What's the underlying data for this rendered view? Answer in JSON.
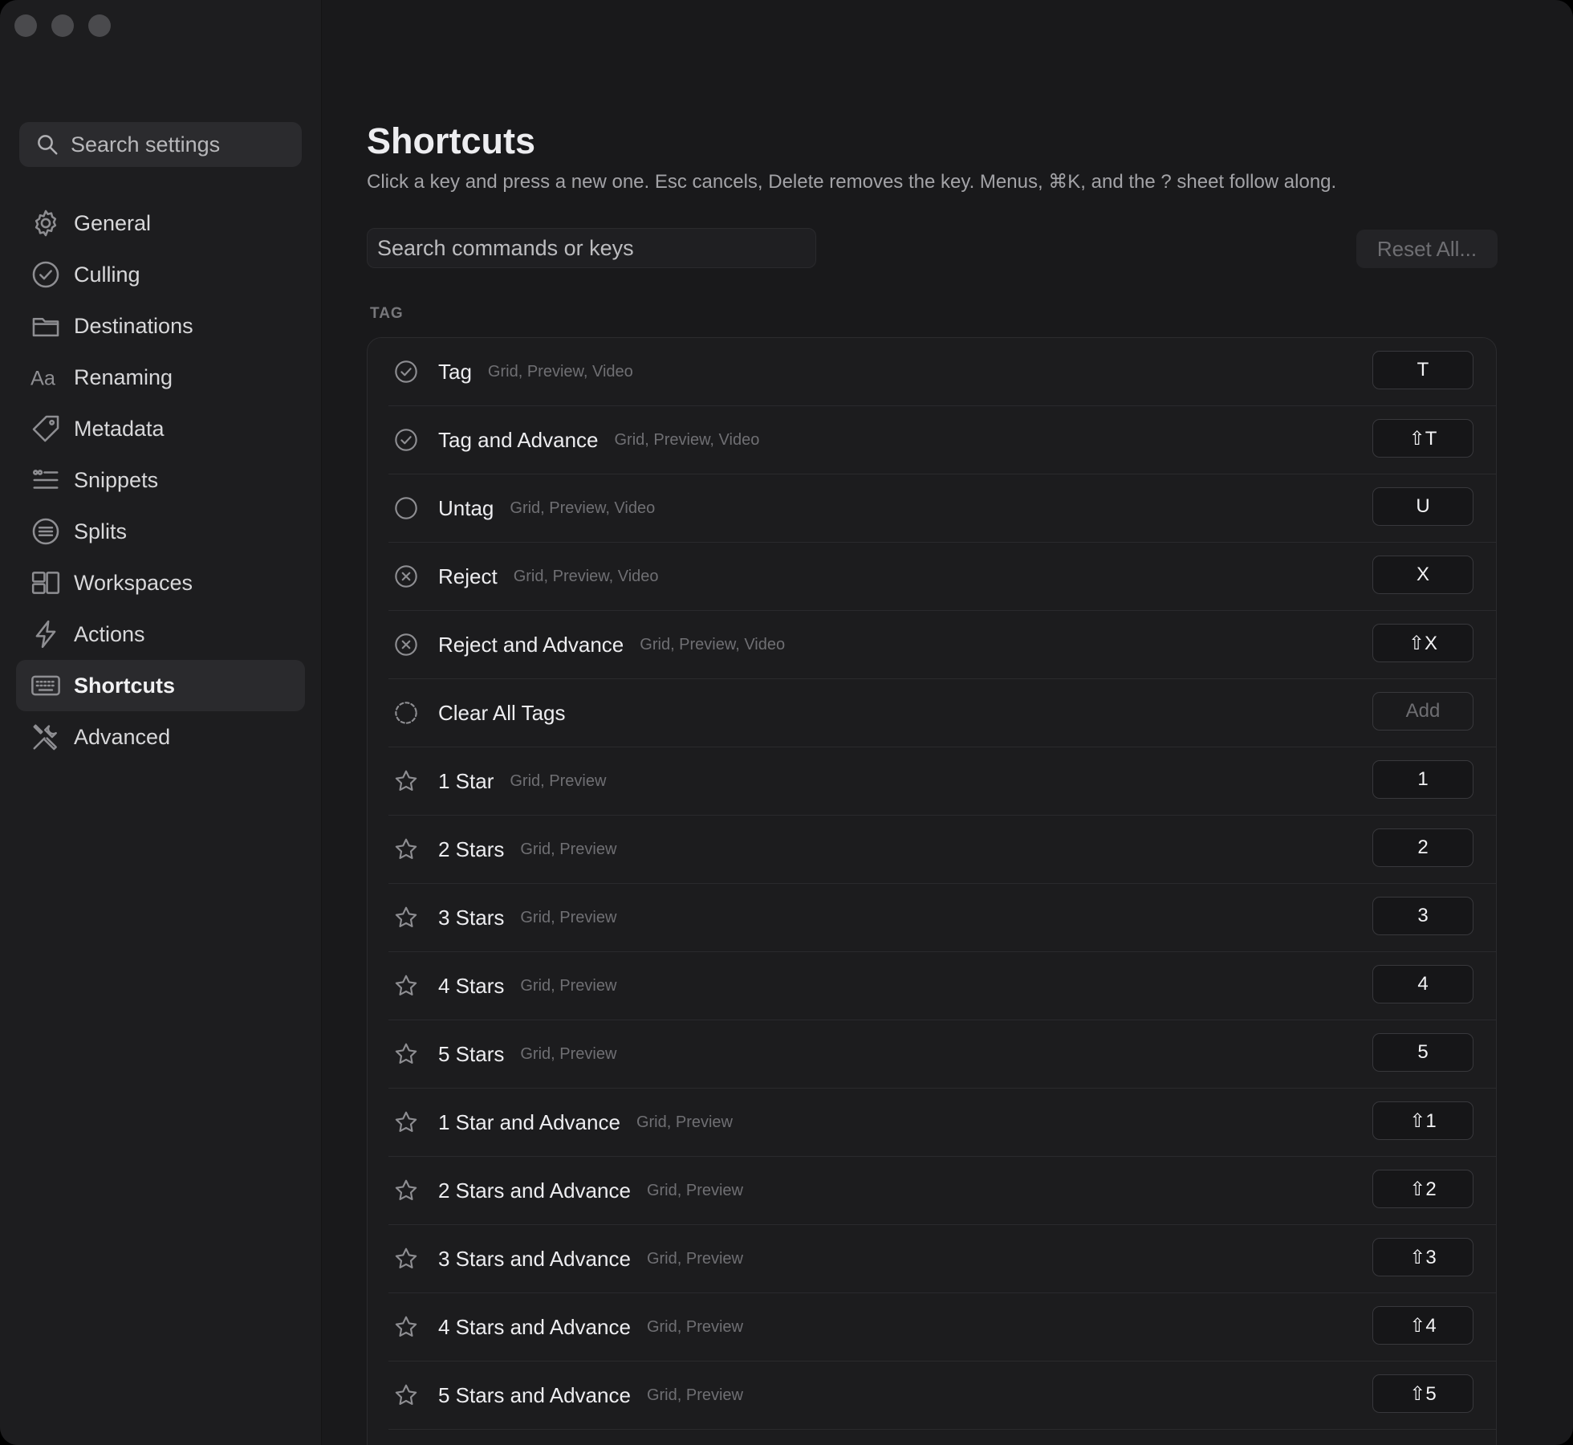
{
  "sidebar": {
    "search_placeholder": "Search settings",
    "items": [
      {
        "label": "General",
        "icon": "gear-icon"
      },
      {
        "label": "Culling",
        "icon": "check-circle-icon"
      },
      {
        "label": "Destinations",
        "icon": "folder-icon"
      },
      {
        "label": "Renaming",
        "icon": "text-aa-icon"
      },
      {
        "label": "Metadata",
        "icon": "tag-icon"
      },
      {
        "label": "Snippets",
        "icon": "snippets-list-icon"
      },
      {
        "label": "Splits",
        "icon": "split-lines-icon"
      },
      {
        "label": "Workspaces",
        "icon": "layout-icon"
      },
      {
        "label": "Actions",
        "icon": "bolt-icon"
      },
      {
        "label": "Shortcuts",
        "icon": "keyboard-icon",
        "active": true
      },
      {
        "label": "Advanced",
        "icon": "tools-icon"
      }
    ]
  },
  "main": {
    "title": "Shortcuts",
    "subtitle": "Click a key and press a new one. Esc cancels, Delete removes the key. Menus, ⌘K, and the ? sheet follow along.",
    "search_placeholder": "Search commands or keys",
    "reset_label": "Reset All...",
    "section_label": "TAG",
    "rows": [
      {
        "name": "Tag",
        "context": "Grid, Preview, Video",
        "key": "T",
        "icon": "check-circle-icon"
      },
      {
        "name": "Tag and Advance",
        "context": "Grid, Preview, Video",
        "key": "⇧T",
        "icon": "check-circle-icon"
      },
      {
        "name": "Untag",
        "context": "Grid, Preview, Video",
        "key": "U",
        "icon": "empty-circle-icon"
      },
      {
        "name": "Reject",
        "context": "Grid, Preview, Video",
        "key": "X",
        "icon": "x-circle-icon"
      },
      {
        "name": "Reject and Advance",
        "context": "Grid, Preview, Video",
        "key": "⇧X",
        "icon": "x-circle-icon"
      },
      {
        "name": "Clear All Tags",
        "context": "",
        "key": "Add",
        "icon": "dashed-circle-icon",
        "unassigned": true
      },
      {
        "name": "1 Star",
        "context": "Grid, Preview",
        "key": "1",
        "icon": "star-icon"
      },
      {
        "name": "2 Stars",
        "context": "Grid, Preview",
        "key": "2",
        "icon": "star-icon"
      },
      {
        "name": "3 Stars",
        "context": "Grid, Preview",
        "key": "3",
        "icon": "star-icon"
      },
      {
        "name": "4 Stars",
        "context": "Grid, Preview",
        "key": "4",
        "icon": "star-icon"
      },
      {
        "name": "5 Stars",
        "context": "Grid, Preview",
        "key": "5",
        "icon": "star-icon"
      },
      {
        "name": "1 Star and Advance",
        "context": "Grid, Preview",
        "key": "⇧1",
        "icon": "star-icon"
      },
      {
        "name": "2 Stars and Advance",
        "context": "Grid, Preview",
        "key": "⇧2",
        "icon": "star-icon"
      },
      {
        "name": "3 Stars and Advance",
        "context": "Grid, Preview",
        "key": "⇧3",
        "icon": "star-icon"
      },
      {
        "name": "4 Stars and Advance",
        "context": "Grid, Preview",
        "key": "⇧4",
        "icon": "star-icon"
      },
      {
        "name": "5 Stars and Advance",
        "context": "Grid, Preview",
        "key": "⇧5",
        "icon": "star-icon"
      }
    ]
  },
  "colors": {
    "window_bg": "#19191b",
    "sidebar_bg": "#1d1d1f",
    "active_item_bg": "#2a2a2d",
    "text_primary": "#ededf0",
    "text_muted": "#6f6f73"
  }
}
